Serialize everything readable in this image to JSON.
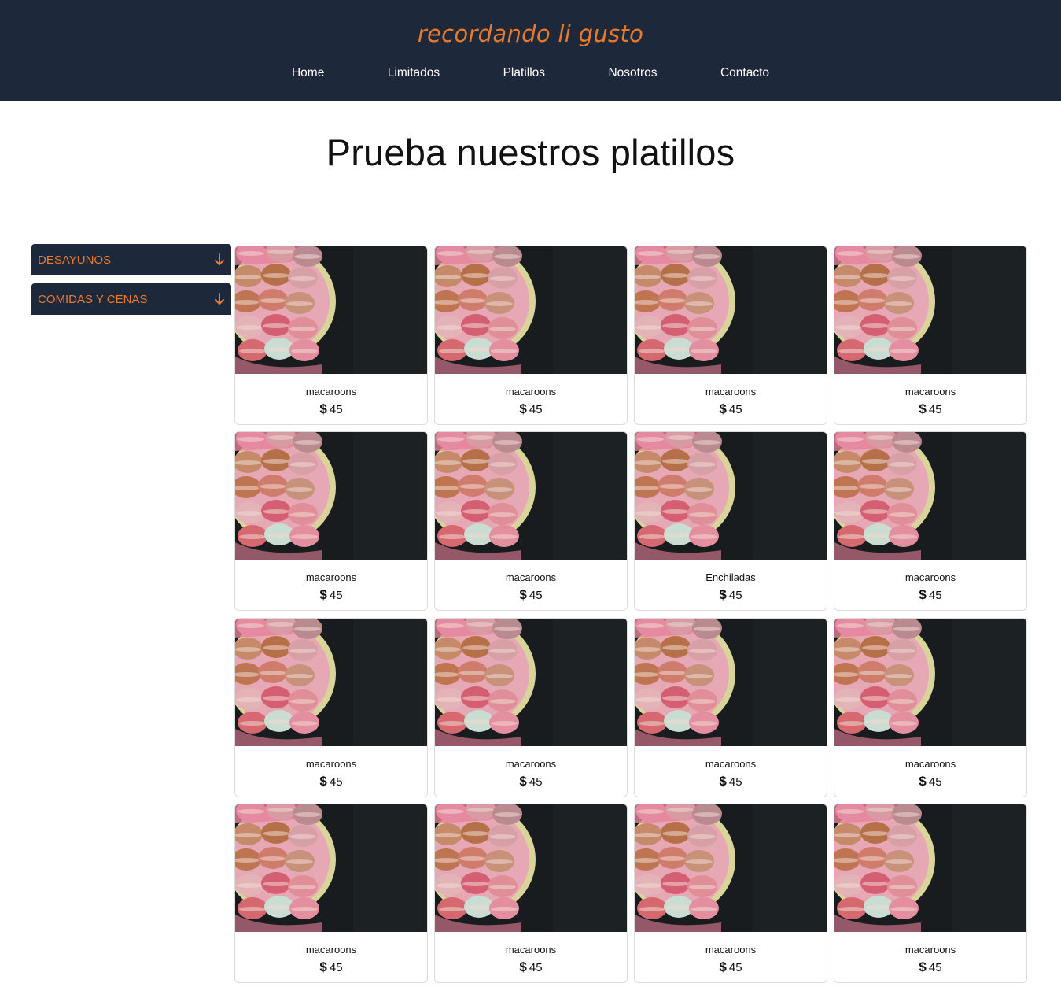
{
  "header": {
    "brand": "recordando li gusto",
    "nav": [
      "Home",
      "Limitados",
      "Platillos",
      "Nosotros",
      "Contacto"
    ]
  },
  "main": {
    "title": "Prueba nuestros platillos"
  },
  "categories": [
    {
      "label": "DESAYUNOS",
      "icon": "arrow-down-icon"
    },
    {
      "label": "COMIDAS Y CENAS",
      "icon": "arrow-down-icon"
    }
  ],
  "products": [
    {
      "name": "macaroons",
      "currency": "$",
      "price": "45"
    },
    {
      "name": "macaroons",
      "currency": "$",
      "price": "45"
    },
    {
      "name": "macaroons",
      "currency": "$",
      "price": "45"
    },
    {
      "name": "macaroons",
      "currency": "$",
      "price": "45"
    },
    {
      "name": "macaroons",
      "currency": "$",
      "price": "45"
    },
    {
      "name": "macaroons",
      "currency": "$",
      "price": "45"
    },
    {
      "name": "Enchiladas",
      "currency": "$",
      "price": "45"
    },
    {
      "name": "macaroons",
      "currency": "$",
      "price": "45"
    },
    {
      "name": "macaroons",
      "currency": "$",
      "price": "45"
    },
    {
      "name": "macaroons",
      "currency": "$",
      "price": "45"
    },
    {
      "name": "macaroons",
      "currency": "$",
      "price": "45"
    },
    {
      "name": "macaroons",
      "currency": "$",
      "price": "45"
    },
    {
      "name": "macaroons",
      "currency": "$",
      "price": "45"
    },
    {
      "name": "macaroons",
      "currency": "$",
      "price": "45"
    },
    {
      "name": "macaroons",
      "currency": "$",
      "price": "45"
    },
    {
      "name": "macaroons",
      "currency": "$",
      "price": "45"
    }
  ],
  "colors": {
    "header_bg": "#1e283b",
    "accent": "#ea7a2a",
    "photo_bg": "#181c1e"
  }
}
